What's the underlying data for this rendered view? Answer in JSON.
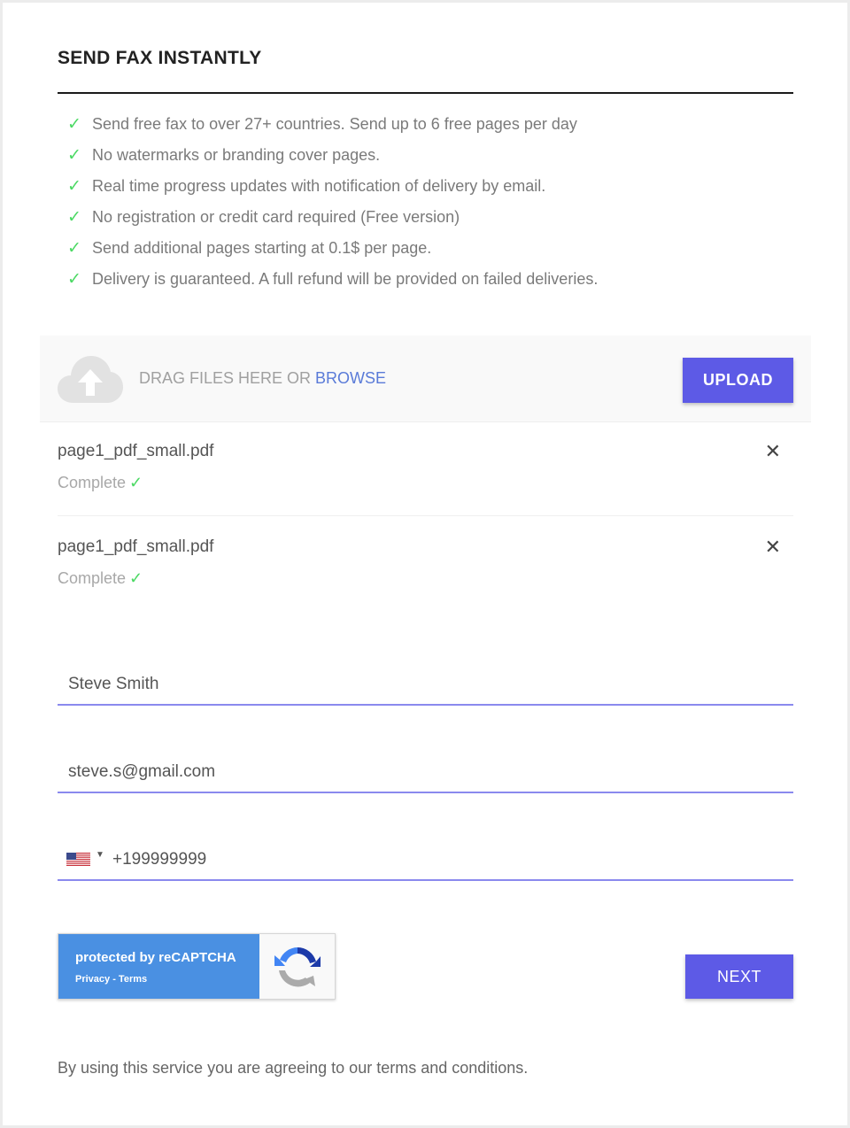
{
  "header": {
    "title": "SEND FAX INSTANTLY"
  },
  "features": [
    "Send free fax to over 27+ countries. Send up to 6 free pages per day",
    "No watermarks or branding cover pages.",
    "Real time progress updates with notification of delivery by email.",
    "No registration or credit card required (Free version)",
    "Send additional pages starting at 0.1$ per page.",
    "Delivery is guaranteed. A full refund will be provided on failed deliveries."
  ],
  "check_glyph": "✓",
  "dropzone": {
    "text": "DRAG FILES HERE OR ",
    "browse_label": "BROWSE",
    "upload_label": "UPLOAD",
    "icon": "cloud-upload-icon"
  },
  "files": [
    {
      "name": "page1_pdf_small.pdf",
      "status": "Complete"
    },
    {
      "name": "page1_pdf_small.pdf",
      "status": "Complete"
    }
  ],
  "form": {
    "name_value": "Steve Smith",
    "email_value": "steve.s@gmail.com",
    "phone_value": "+199999999",
    "country_flag": "us-flag-icon"
  },
  "recaptcha": {
    "title": "protected by reCAPTCHA",
    "links": "Privacy - Terms"
  },
  "actions": {
    "next_label": "NEXT"
  },
  "footer": {
    "terms": "By using this service you are agreeing to our terms and conditions."
  },
  "colors": {
    "accent": "#5d5ae6",
    "check": "#4cd964",
    "link": "#5a7bd8",
    "recaptcha_blue": "#4a90e2"
  }
}
